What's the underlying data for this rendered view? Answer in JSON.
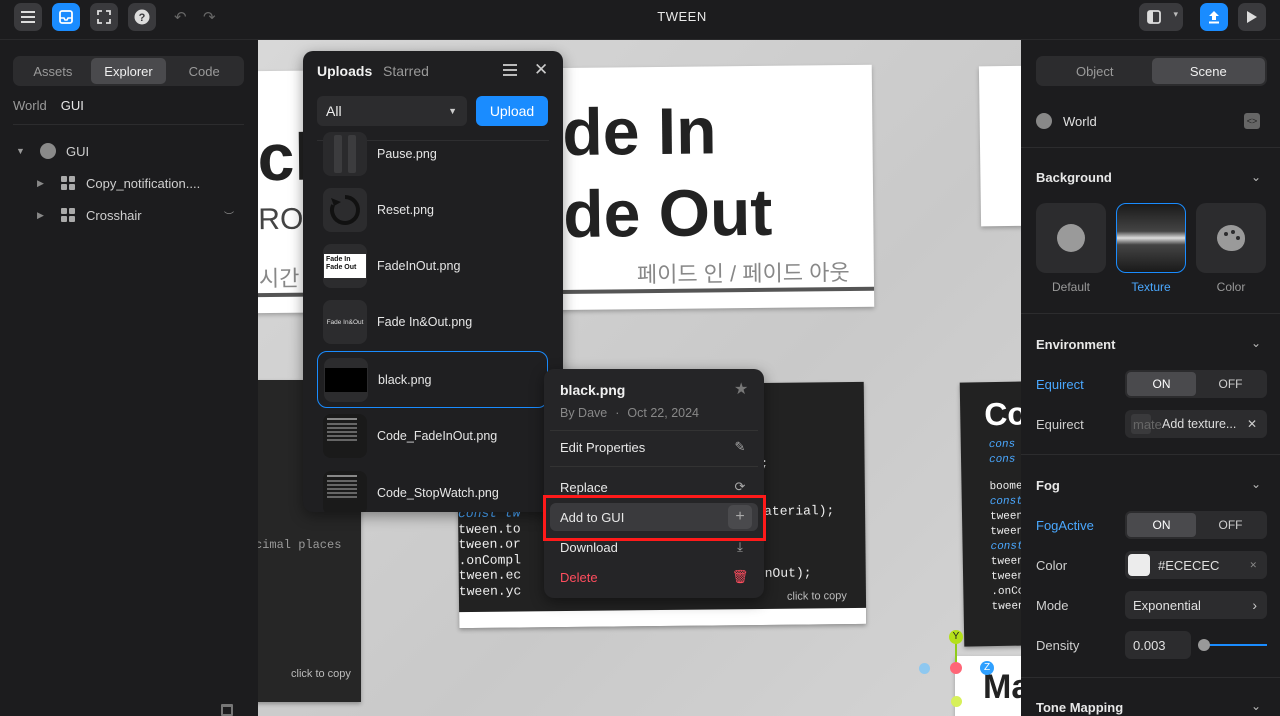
{
  "app": {
    "title": "TWEEN"
  },
  "left_panel": {
    "tabs": [
      {
        "label": "Assets"
      },
      {
        "label": "Explorer"
      },
      {
        "label": "Code"
      }
    ],
    "crumbs": [
      {
        "label": "World"
      },
      {
        "label": "GUI"
      }
    ],
    "tree": [
      {
        "label": "GUI"
      },
      {
        "label": "Copy_notification...."
      },
      {
        "label": "Crosshair"
      }
    ]
  },
  "uploads": {
    "tabs": [
      {
        "label": "Uploads"
      },
      {
        "label": "Starred"
      }
    ],
    "filter_value": "All",
    "upload_label": "Upload",
    "items": [
      {
        "name": "Pause.png"
      },
      {
        "name": "Reset.png"
      },
      {
        "name": "FadeInOut.png",
        "thumb_text": "Fade In\nFade Out"
      },
      {
        "name": "Fade In&Out.png",
        "thumb_text": "Fade In&Out"
      },
      {
        "name": "black.png"
      },
      {
        "name": "Code_FadeInOut.png"
      },
      {
        "name": "Code_StopWatch.png"
      }
    ]
  },
  "context_menu": {
    "title": "black.png",
    "author": "By Dave",
    "date": "Oct 22, 2024",
    "items": [
      {
        "label": "Edit Properties"
      },
      {
        "label": "Replace"
      },
      {
        "label": "Add to GUI"
      },
      {
        "label": "Download"
      },
      {
        "label": "Delete"
      }
    ]
  },
  "viewport": {
    "card1_big1": "de In",
    "card1_big2": "de Out",
    "card1_partial": "ch",
    "card1_partial2": "RO",
    "card1_korean": "페이드 인 / 페이드 아웃",
    "card1_korean_left": "시간",
    "code_lines_left": [
      "const tw",
      "tween.to",
      "tween.or",
      ".onCompl",
      "tween.ec",
      "tween.yc"
    ],
    "code_right_fragments": [
      ";",
      "aterial);",
      "nOut);"
    ],
    "click_to_copy": "click to copy",
    "decimal_text": "cimal places",
    "card3_title": "Co",
    "card3_lines": [
      "cons",
      "cons",
      "boome",
      "const",
      "tween",
      "tween",
      "const",
      "tween",
      "tween",
      ".onCo",
      "tween."
    ],
    "bottom_text": "Ma",
    "gizmo_y": "Y",
    "gizmo_z": "Z"
  },
  "right_panel": {
    "tabs": [
      {
        "label": "Object"
      },
      {
        "label": "Scene"
      }
    ],
    "world_label": "World",
    "background": {
      "title": "Background",
      "options": [
        {
          "label": "Default"
        },
        {
          "label": "Texture"
        },
        {
          "label": "Color"
        }
      ]
    },
    "environment": {
      "title": "Environment",
      "equirect_toggle_label": "Equirect",
      "on": "ON",
      "off": "OFF",
      "equirect_label": "Equirect",
      "equirect_placeholder": "mate",
      "add_texture": "Add texture..."
    },
    "fog": {
      "title": "Fog",
      "active_label": "FogActive",
      "on": "ON",
      "off": "OFF",
      "color_label": "Color",
      "color_value": "#ECECEC",
      "mode_label": "Mode",
      "mode_value": "Exponential",
      "density_label": "Density",
      "density_value": "0.003",
      "density_fraction": 0.05
    },
    "tone_mapping": {
      "title": "Tone Mapping"
    }
  },
  "colors": {
    "accent": "#1a8cff",
    "danger": "#ff4d5e",
    "highlight": "#ff1a1a",
    "link": "#4aa8ff"
  }
}
